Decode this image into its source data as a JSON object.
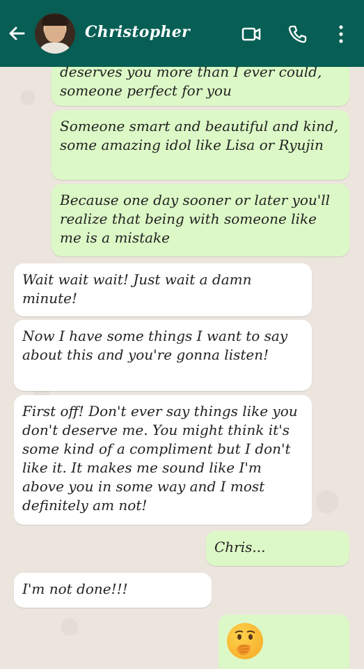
{
  "header": {
    "contact_name": "Christopher",
    "icons": [
      "back-arrow-icon",
      "avatar",
      "video-call-icon",
      "phone-icon",
      "more-options-icon"
    ]
  },
  "messages": [
    {
      "direction": "outgoing",
      "text": "deserves you more than I ever could, someone perfect for you"
    },
    {
      "direction": "outgoing",
      "text": "Someone smart and beautiful and kind, some amazing idol like Lisa or Ryujin"
    },
    {
      "direction": "outgoing",
      "text": "Because one day sooner or later you'll realize that being with someone like me is a mistake"
    },
    {
      "direction": "incoming",
      "text": "Wait wait wait! Just wait a damn minute!"
    },
    {
      "direction": "incoming",
      "text": "Now I have some things I want to say about this and you're gonna listen!"
    },
    {
      "direction": "incoming",
      "text": "First off! Don't ever say things like you don't deserve me. You might think it's some kind of a compliment but I don't like it. It makes me sound like I'm above you in some way and I most definitely am not!"
    },
    {
      "direction": "outgoing",
      "text": "Chris..."
    },
    {
      "direction": "incoming",
      "text": "I'm not done!!!"
    },
    {
      "direction": "outgoing",
      "text": "",
      "emoji": "face-with-hand-over-mouth-emoji"
    }
  ],
  "colors": {
    "header": "#075e54",
    "outgoing_bubble": "#dcf8c6",
    "incoming_bubble": "#ffffff",
    "background": "#ece5dd"
  }
}
